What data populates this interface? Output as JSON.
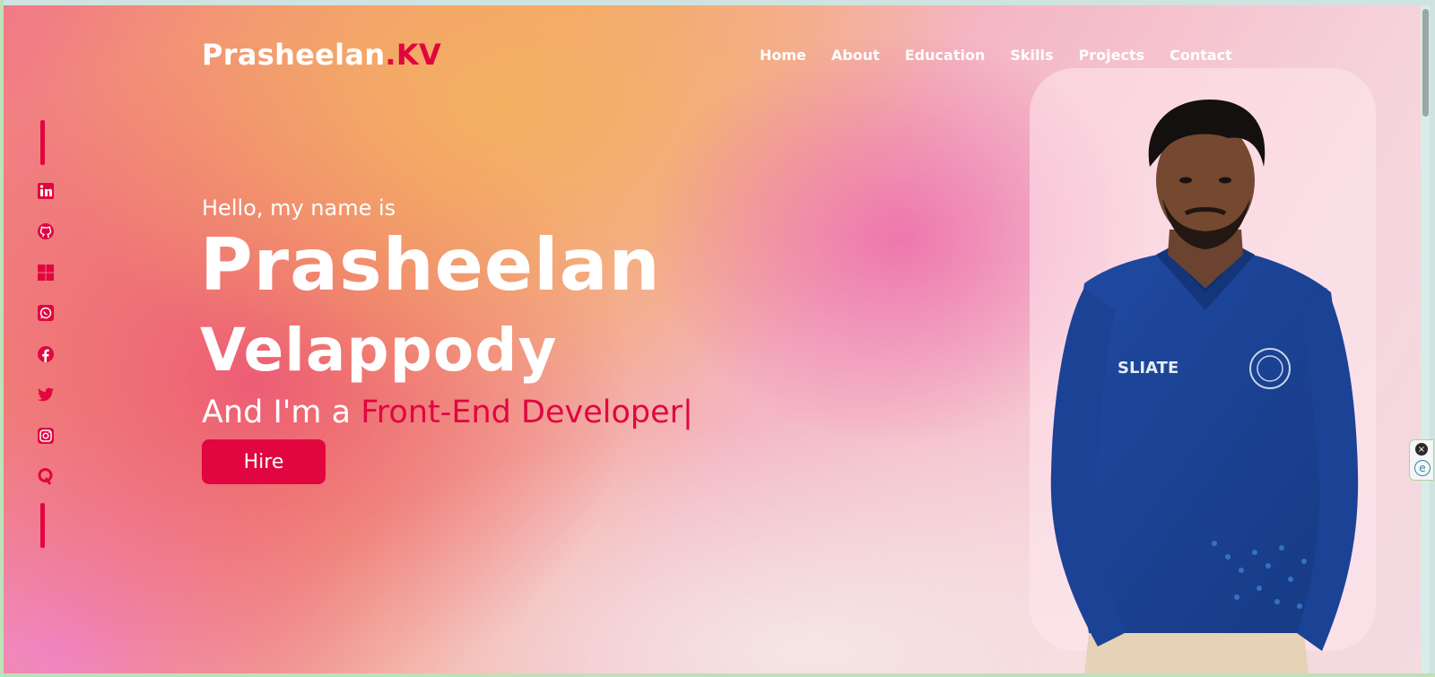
{
  "header": {
    "logo_main": "Prasheelan",
    "logo_accent": ".KV",
    "nav": [
      "Home",
      "About",
      "Education",
      "Skills",
      "Projects",
      "Contact"
    ]
  },
  "hero": {
    "greeting": "Hello, my name is",
    "first_name": "Prasheelan",
    "last_name": "Velappody",
    "role_prefix": "And I'm a ",
    "role": "Front-End Developer",
    "cursor": "|",
    "hire_label": "Hire"
  },
  "social": [
    "linkedin-icon",
    "github-icon",
    "windows-icon",
    "whatsapp-icon",
    "facebook-icon",
    "twitter-icon",
    "instagram-icon",
    "quora-icon"
  ],
  "photo": {
    "shirt_text": "SLIATE"
  },
  "colors": {
    "accent": "#e1063f",
    "text": "#ffffff",
    "shirt": "#1d3f8f"
  },
  "extension": {
    "close": "×",
    "e": "e"
  }
}
